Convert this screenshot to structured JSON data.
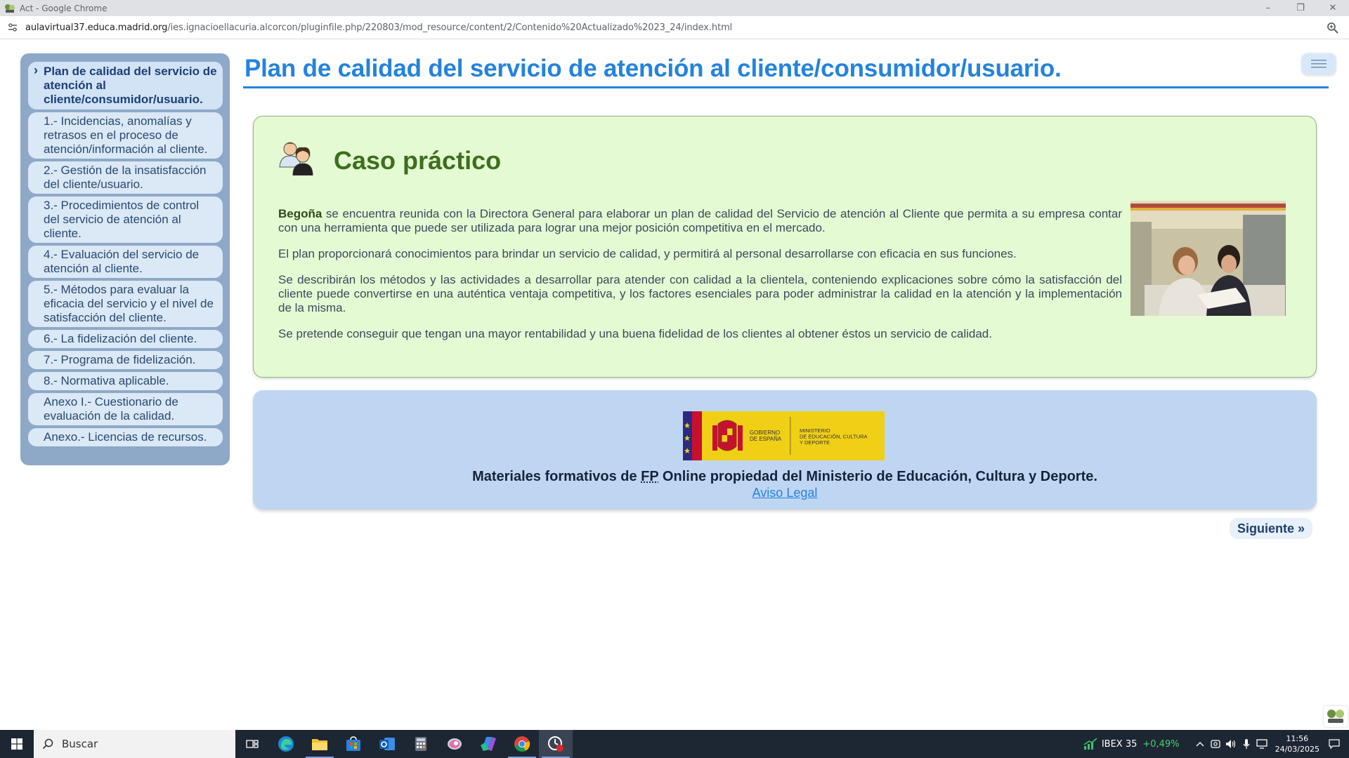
{
  "browser": {
    "window_title": "Act - Google Chrome",
    "url_host": "aulavirtual37.educa.madrid.org",
    "url_path": "/ies.ignacioellacuria.alcorcon/pluginfile.php/220803/mod_resource/content/2/Contenido%20Actualizado%2023_24/index.html",
    "controls": {
      "minimize": "–",
      "restore": "❐",
      "close": "✕"
    }
  },
  "sidebar": {
    "items": [
      {
        "label": "Plan de calidad del servicio de atención al cliente/consumidor/usuario.",
        "active": true
      },
      {
        "label": "1.- Incidencias, anomalías y retrasos en el proceso de atención/información al cliente."
      },
      {
        "label": "2.- Gestión de la insatisfacción del cliente/usuario."
      },
      {
        "label": "3.- Procedimientos de control del servicio de atención al cliente."
      },
      {
        "label": "4.- Evaluación del servicio de atención al cliente."
      },
      {
        "label": "5.- Métodos para evaluar la eficacia del servicio y el nivel de satisfacción del cliente."
      },
      {
        "label": "6.- La fidelización del cliente."
      },
      {
        "label": "7.- Programa de fidelización."
      },
      {
        "label": "8.- Normativa aplicable."
      },
      {
        "label": "Anexo I.- Cuestionario de evaluación de la calidad."
      },
      {
        "label": "Anexo.- Licencias de recursos."
      }
    ]
  },
  "main": {
    "title": "Plan de calidad del servicio de atención al cliente/consumidor/usuario.",
    "case": {
      "heading": "Caso práctico",
      "name": "Begoña",
      "p1_rest": " se encuentra reunida con la Directora General para elaborar un plan de calidad del Servicio de atención al Cliente que permita a su empresa contar con una herramienta que puede ser utilizada para lograr una mejor posición competitiva en el mercado.",
      "p2": "El plan proporcionará conocimientos para brindar un servicio de calidad, y permitirá al personal desarrollarse con eficacia en sus funciones.",
      "p3": "Se describirán los métodos y las actividades a desarrollar para atender con calidad a la clientela, conteniendo explicaciones sobre cómo la satisfacción del cliente puede convertirse en una auténtica ventaja competitiva, y los factores esenciales para poder administrar la calidad en la atención y la implementación de la misma.",
      "p4": "Se pretende conseguir que tengan una mayor rentabilidad y una buena fidelidad de los clientes al obtener éstos un servicio de calidad."
    },
    "footer": {
      "logo_left": "GOBIERNO DE ESPAÑA",
      "logo_right": "MINISTERIO DE EDUCACIÓN, CULTURA Y DEPORTE",
      "text_before": "Materiales formativos de ",
      "abbr": "FP",
      "text_after": " Online propiedad del Ministerio de Educación, Cultura y Deporte.",
      "link": "Aviso Legal"
    },
    "next_label": "Siguiente »"
  },
  "taskbar": {
    "search_placeholder": "Buscar",
    "ibex_label": "IBEX 35",
    "ibex_change": "+0,49%",
    "time": "11:56",
    "date": "24/03/2025"
  },
  "colors": {
    "accent": "#2483dd",
    "sidebar_bg": "#8ea9c8",
    "case_bg": "#e4fad2",
    "footer_bg": "#bfd6f3"
  }
}
